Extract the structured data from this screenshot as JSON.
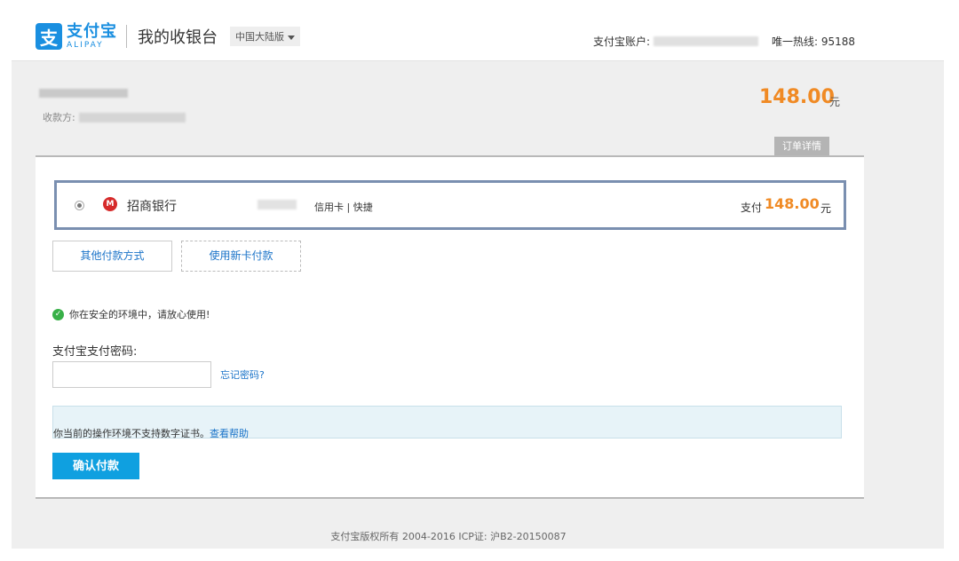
{
  "header": {
    "logo_mark": "支",
    "logo_cn": "支付宝",
    "logo_en": "ALIPAY",
    "cashier_title": "我的收银台",
    "region": "中国大陆版",
    "account_label": "支付宝账户:",
    "hotline": "唯一热线: 95188"
  },
  "order": {
    "payee_label": "收款方:",
    "amount": "148.00",
    "unit": "元",
    "detail_button": "订单详情"
  },
  "payment": {
    "bank_icon": "M",
    "bank_name": "招商银行",
    "card_type": "信用卡 | 快捷",
    "pay_label": "支付",
    "pay_amount": "148.00",
    "pay_unit": "元",
    "other_methods": "其他付款方式",
    "new_card": "使用新卡付款"
  },
  "security": {
    "check_icon": "✓",
    "message": "你在安全的环境中，请放心使用!",
    "password_label": "支付宝支付密码:",
    "password_value": "",
    "forgot": "忘记密码?"
  },
  "notice": {
    "text": "你当前的操作环境不支持数字证书。",
    "link": "查看帮助"
  },
  "confirm_button": "确认付款",
  "footer": "支付宝版权所有 2004-2016 ICP证: 沪B2-20150087",
  "colors": {
    "brand": "#1a8fe0",
    "amount": "#f08a24",
    "link": "#1a73c8",
    "confirm": "#0fa0e0"
  }
}
